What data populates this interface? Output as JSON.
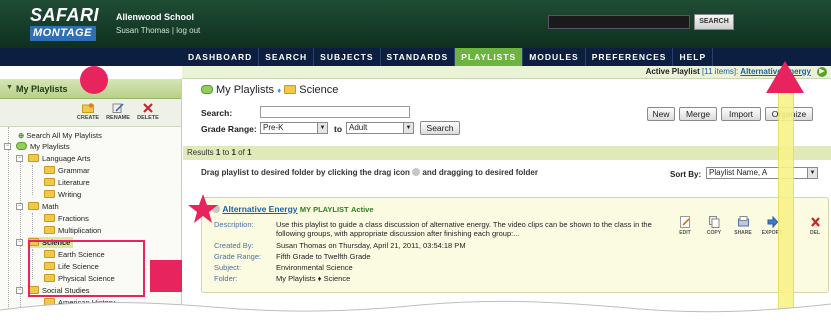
{
  "header": {
    "logo_top": "SAFARI",
    "logo_bottom": "MONTAGE",
    "school": "Allenwood School",
    "user": "Susan Thomas",
    "sep": "|",
    "logout": "log out",
    "search_button": "SEARCH"
  },
  "nav": {
    "items": [
      "DASHBOARD",
      "SEARCH",
      "SUBJECTS",
      "STANDARDS",
      "PLAYLISTS",
      "MODULES",
      "PREFERENCES",
      "HELP"
    ],
    "active": "PLAYLISTS"
  },
  "active_playlist": {
    "label": "Active Playlist",
    "count": "[11 items]:",
    "name": "Alternative Energy"
  },
  "sidebar": {
    "title": "My Playlists",
    "tools": [
      "CREATE",
      "RENAME",
      "DELETE"
    ],
    "search_all": "Search All My Playlists",
    "tree": {
      "root": "My Playlists",
      "language_arts": "Language Arts",
      "grammar": "Grammar",
      "literature": "Literature",
      "writing": "Writing",
      "math": "Math",
      "fractions": "Fractions",
      "multiplication": "Multiplication",
      "science": "Science",
      "earth_science": "Earth Science",
      "life_science": "Life Science",
      "physical_science": "Physical Science",
      "social_studies": "Social Studies",
      "american_history": "American History"
    }
  },
  "main": {
    "crumb_root": "My Playlists",
    "crumb_sep": "♦",
    "crumb_current": "Science",
    "search_label": "Search:",
    "search_value": "",
    "grade_label": "Grade Range:",
    "grade_from": "Pre-K",
    "grade_to_label": "to",
    "grade_to": "Adult",
    "search_button": "Search",
    "buttons": [
      "New",
      "Merge",
      "Import",
      "Organize"
    ],
    "results": {
      "prefix": "Results ",
      "from": "1",
      "to_word": " to ",
      "to": "1",
      "of_word": " of ",
      "total": "1"
    },
    "hint_before": "Drag playlist to desired folder by clicking the drag icon",
    "hint_after": "and dragging to desired folder",
    "sort_label": "Sort By:",
    "sort_value": "Playlist Name, A"
  },
  "playlist": {
    "title": "Alternative Energy",
    "type": "MY PLAYLIST",
    "status": "Active",
    "description_label": "Description:",
    "description": "Use this playlist to guide a class discussion of alternative energy. The video clips can be shown to the class in the following groups, with appropriate discussion after finishing each group:...",
    "created_label": "Created By:",
    "created": "Susan Thomas on Thursday, April 21, 2011, 03:54:18 PM",
    "grade_label": "Grade Range:",
    "grade": "Fifth Grade to Twelfth Grade",
    "subject_label": "Subject:",
    "subject": "Environmental Science",
    "folder_label": "Folder:",
    "folder": "My Playlists ♦ Science",
    "actions": [
      "EDIT",
      "COPY",
      "SHARE",
      "EXPORT",
      "DEL"
    ]
  },
  "colors": {
    "accent_pink": "#e8245f",
    "nav_bg": "#0d1f40",
    "nav_active": "#6db33f",
    "header_green": "#1f4d34",
    "link_blue": "#1f5fa5",
    "highlight_yellow": "#f8f28a"
  }
}
